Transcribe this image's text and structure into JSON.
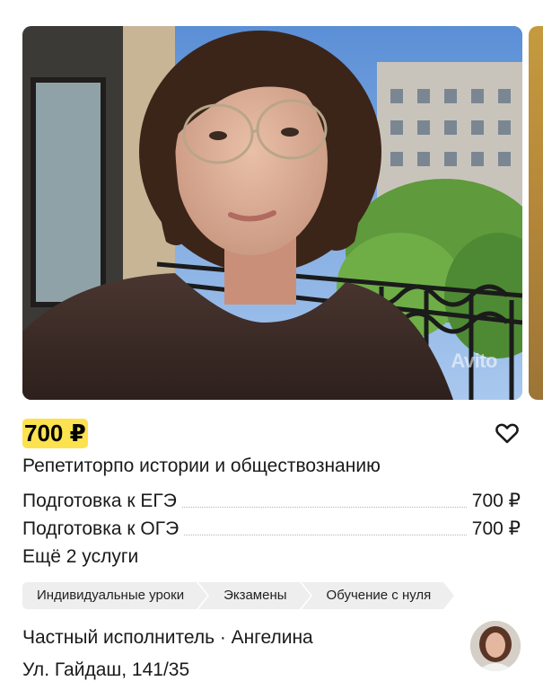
{
  "listing": {
    "price": "700 ₽",
    "title": "Репетиторпо истории и обществознанию",
    "photo_watermark": "Avito",
    "services": [
      {
        "name": "Подготовка к ЕГЭ",
        "price": "700 ₽"
      },
      {
        "name": "Подготовка к ОГЭ",
        "price": "700 ₽"
      }
    ],
    "more_services": "Ещё 2 услуги",
    "tags": [
      "Индивидуальные уроки",
      "Экзамены",
      "Обучение с нуля"
    ],
    "seller": "Частный исполнитель · Ангелина",
    "address": "Ул. Гайдаш, 141/35"
  },
  "icons": {
    "favorite": "heart-outline-icon"
  },
  "colors": {
    "price_highlight": "#fde24f",
    "tag_background": "#eeeeee",
    "text": "#1a1a1a"
  }
}
